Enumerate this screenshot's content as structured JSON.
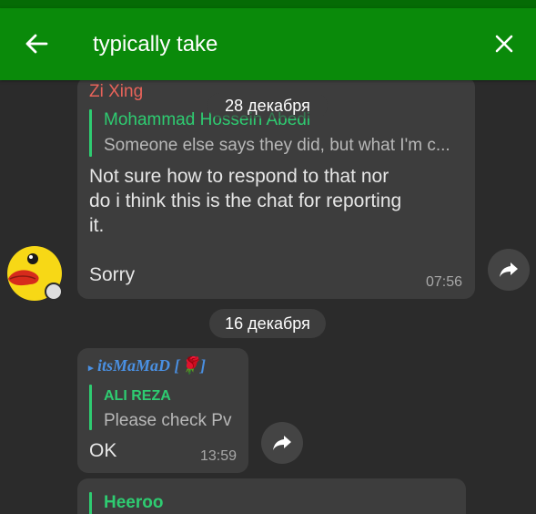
{
  "search": {
    "query": "typically take"
  },
  "icons": {
    "back": "arrow-left-icon",
    "close": "close-icon",
    "forward": "share-arrow-icon"
  },
  "colors": {
    "toolbar": "#0a8a0a",
    "status_bar": "#056b05",
    "background": "#2b2b2b",
    "bubble": "#3d3d3d",
    "reply_accent": "#2ecc71",
    "sender_zixing": "#e8635a",
    "sender_itsmamad": "#4a90e2"
  },
  "messages": [
    {
      "sender": "Zi Xing",
      "floating_date": "28 декабря",
      "reply_name": "Mohammad Hossein Abedi",
      "reply_text": "Someone else says they did, but what I'm c...",
      "lines": [
        "Not sure how to respond to that nor",
        "do i think this is the chat for reporting",
        "it.",
        "",
        "Sorry"
      ],
      "time": "07:56"
    },
    {
      "sender": "itsMaMaD [🌹]",
      "reply_name": "ALI REZA",
      "reply_text": "Please check Pv",
      "text": "OK",
      "time": "13:59"
    },
    {
      "reply_name": "Heeroo"
    }
  ],
  "date_separator": "16 декабря"
}
